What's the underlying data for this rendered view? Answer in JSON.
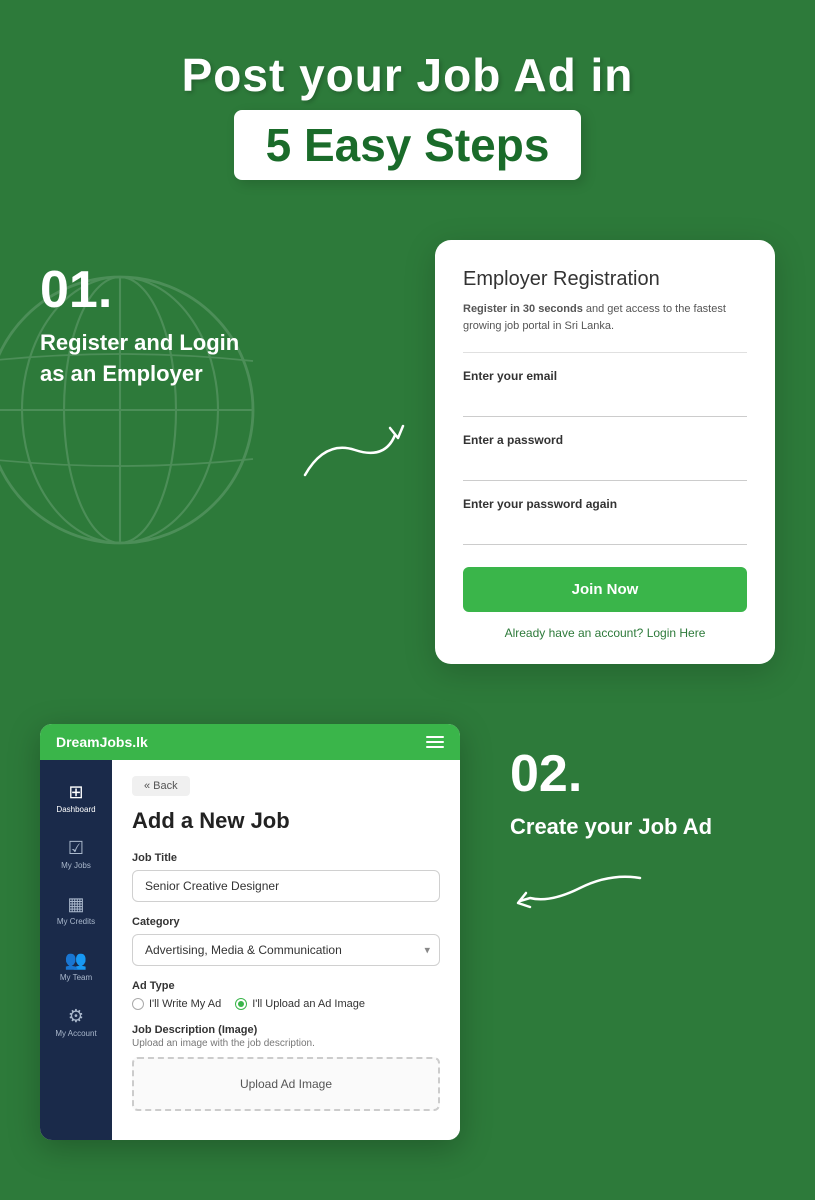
{
  "page": {
    "bg_color": "#2d7a3a",
    "title_line1": "Post your Job Ad in",
    "title_badge": "5 Easy Steps"
  },
  "step1": {
    "number": "01.",
    "description_line1": "Register and Login",
    "description_line2": "as an Employer"
  },
  "registration": {
    "title": "Employer Registration",
    "subtitle_bold": "Register in 30 seconds",
    "subtitle_rest": " and get access to the fastest growing job portal in Sri Lanka.",
    "email_label": "Enter your email",
    "password_label": "Enter a password",
    "password_confirm_label": "Enter your password again",
    "join_btn": "Join Now",
    "login_link": "Already have an account? Login Here"
  },
  "step2": {
    "number": "02.",
    "description": "Create your Job Ad"
  },
  "dashboard": {
    "logo": "DreamJobs.lk",
    "back_btn": "« Back",
    "page_title": "Add a New Job",
    "job_title_label": "Job Title",
    "job_title_value": "Senior Creative Designer",
    "category_label": "Category",
    "category_value": "Advertising, Media & Communication",
    "ad_type_label": "Ad Type",
    "radio_option1": "I'll Write My Ad",
    "radio_option2": "I'll Upload an Ad Image",
    "job_desc_label": "Job Description (Image)",
    "job_desc_sublabel": "Upload an image with the job description.",
    "upload_text": "Upload Ad Image"
  },
  "sidebar": {
    "items": [
      {
        "label": "Dashboard",
        "icon": "⊞",
        "active": true
      },
      {
        "label": "My Jobs",
        "icon": "✓",
        "active": false
      },
      {
        "label": "My Credits",
        "icon": "▦",
        "active": false
      },
      {
        "label": "My Team",
        "icon": "👥",
        "active": false
      },
      {
        "label": "My Account",
        "icon": "⚙",
        "active": false
      }
    ]
  }
}
